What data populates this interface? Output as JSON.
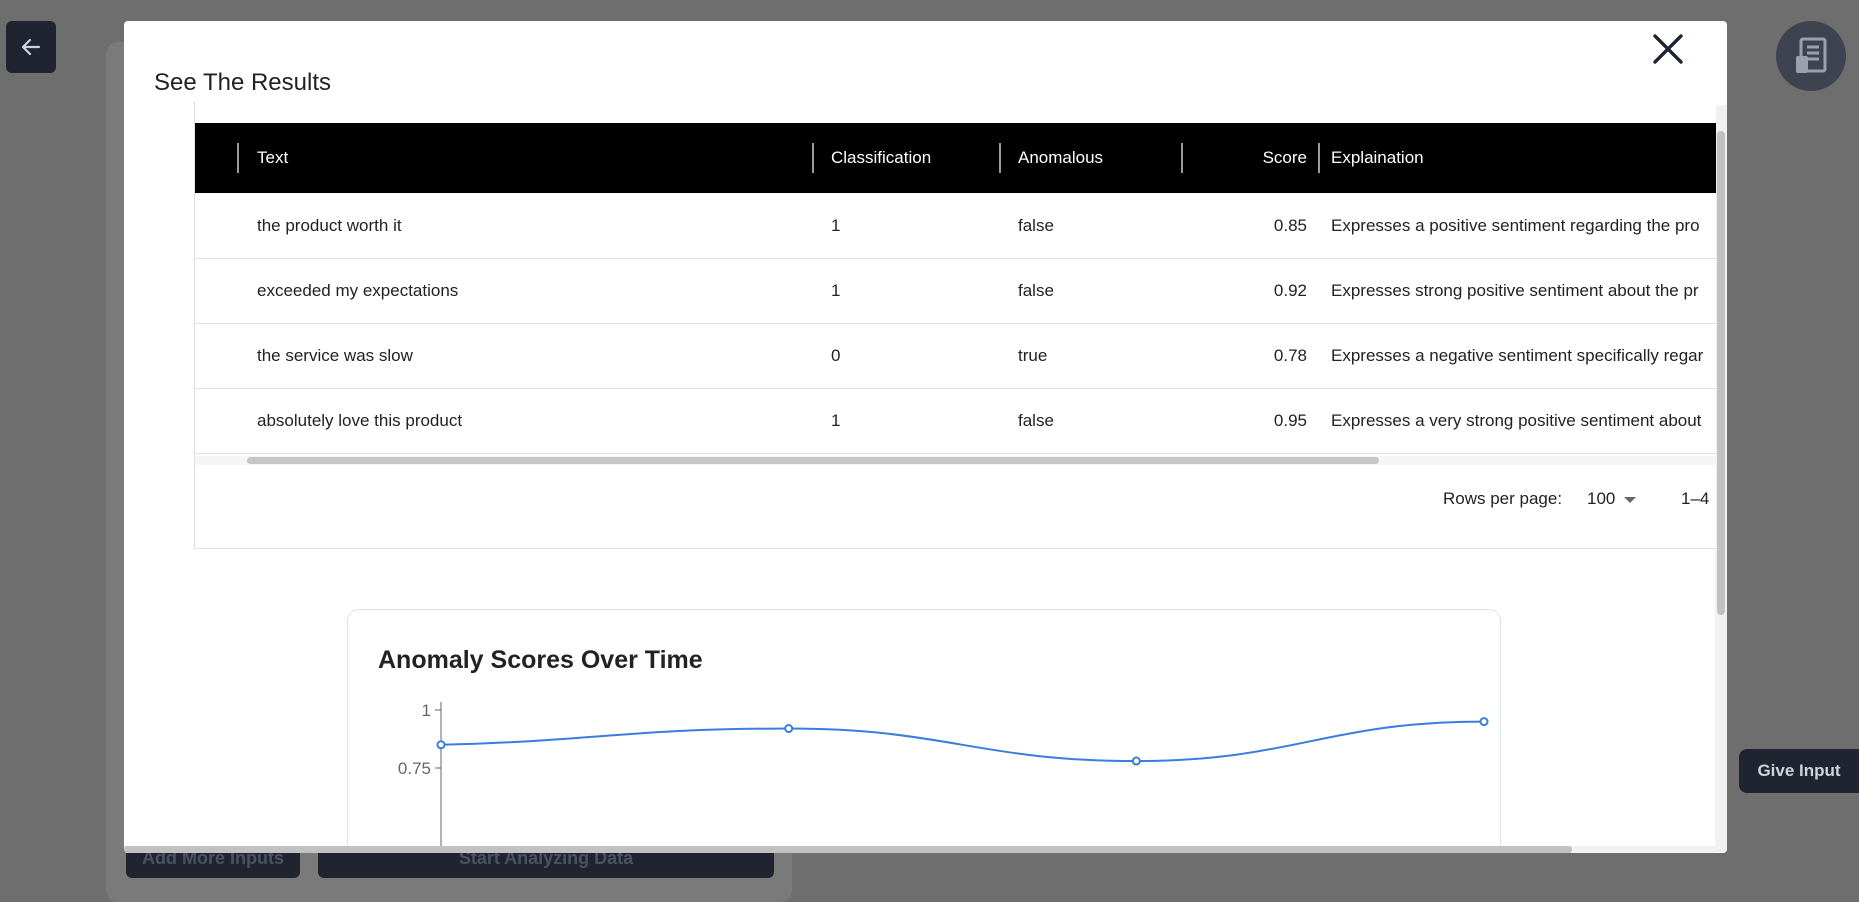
{
  "background": {
    "add_more_inputs": "Add More Inputs",
    "start_analyzing": "Start Analyzing Data",
    "give_input": "Give Input"
  },
  "modal": {
    "title": "See The Results",
    "close_icon": "close-icon"
  },
  "table": {
    "columns": [
      "Text",
      "Classification",
      "Anomalous",
      "Score",
      "Explaination"
    ],
    "rows": [
      {
        "text": "the product worth it",
        "classification": "1",
        "anomalous": "false",
        "score": "0.85",
        "explanation": "Expresses a positive sentiment regarding the pro"
      },
      {
        "text": "exceeded my expectations",
        "classification": "1",
        "anomalous": "false",
        "score": "0.92",
        "explanation": "Expresses strong positive sentiment about the pr"
      },
      {
        "text": "the service was slow",
        "classification": "0",
        "anomalous": "true",
        "score": "0.78",
        "explanation": "Expresses a negative sentiment specifically regar"
      },
      {
        "text": "absolutely love this product",
        "classification": "1",
        "anomalous": "false",
        "score": "0.95",
        "explanation": "Expresses a very strong positive sentiment about"
      }
    ],
    "rows_per_page_label": "Rows per page:",
    "rows_per_page_value": "100",
    "range": "1–4"
  },
  "chart_data": {
    "type": "line",
    "title": "Anomaly Scores Over Time",
    "x": [
      1,
      2,
      3,
      4
    ],
    "series": [
      {
        "values": [
          0.85,
          0.92,
          0.78,
          0.95
        ]
      }
    ],
    "yticks": [
      "1",
      "0.75"
    ],
    "ylim": [
      0.7,
      1
    ],
    "line_color": "#3b7ddd"
  },
  "colors": {
    "header_bg": "#000000",
    "overlay": "#6e6e6e",
    "accent": "#3b7ddd"
  }
}
